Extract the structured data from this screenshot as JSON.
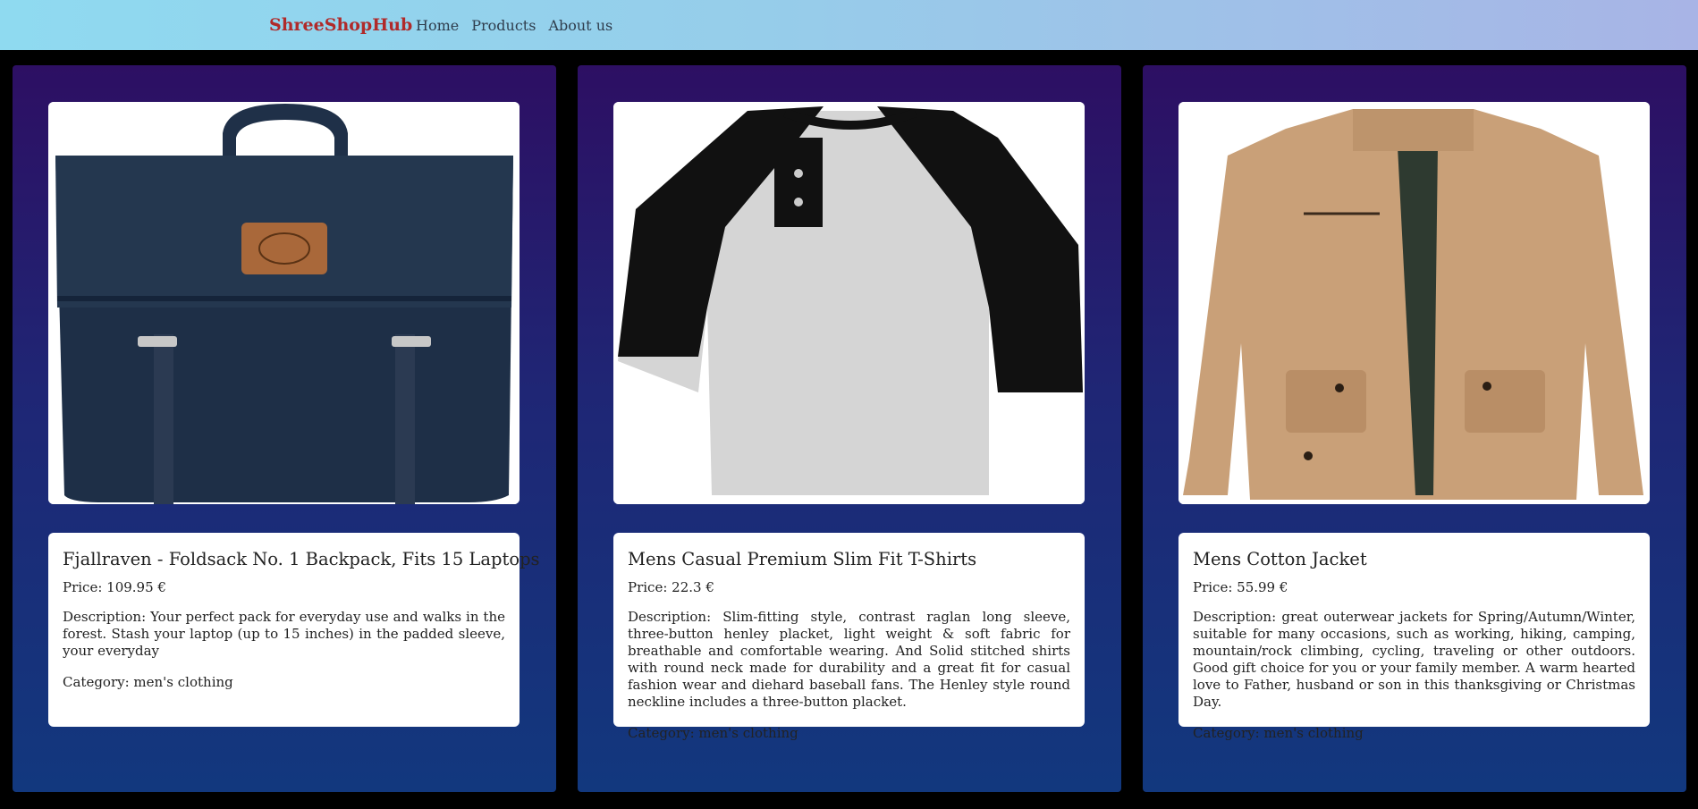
{
  "navbar": {
    "brand": "ShreeShopHub",
    "links": [
      "Home",
      "Products",
      "About us"
    ]
  },
  "products": [
    {
      "title": "Fjallraven - Foldsack No. 1 Backpack, Fits 15 Laptops",
      "price": "Price: 109.95 €",
      "description": "Description: Your perfect pack for everyday use and walks in the forest. Stash your laptop (up to 15 inches) in the padded sleeve, your everyday",
      "category": "Category: men's clothing",
      "image": "backpack"
    },
    {
      "title": "Mens Casual Premium Slim Fit T-Shirts",
      "price": "Price: 22.3 €",
      "description": "Description: Slim-fitting style, contrast raglan long sleeve, three-button henley placket, light weight & soft fabric for breathable and comfortable wearing. And Solid stitched shirts with round neck made for durability and a great fit for casual fashion wear and diehard baseball fans. The Henley style round neckline includes a three-button placket.",
      "category": "Category: men's clothing",
      "image": "t-shirt"
    },
    {
      "title": "Mens Cotton Jacket",
      "price": "Price: 55.99 €",
      "description": "Description: great outerwear jackets for Spring/Autumn/Winter, suitable for many occasions, such as working, hiking, camping, mountain/rock climbing, cycling, traveling or other outdoors. Good gift choice for you or your family member. A warm hearted love to Father, husband or son in this thanksgiving or Christmas Day.",
      "category": "Category: men's clothing",
      "image": "jacket"
    }
  ]
}
